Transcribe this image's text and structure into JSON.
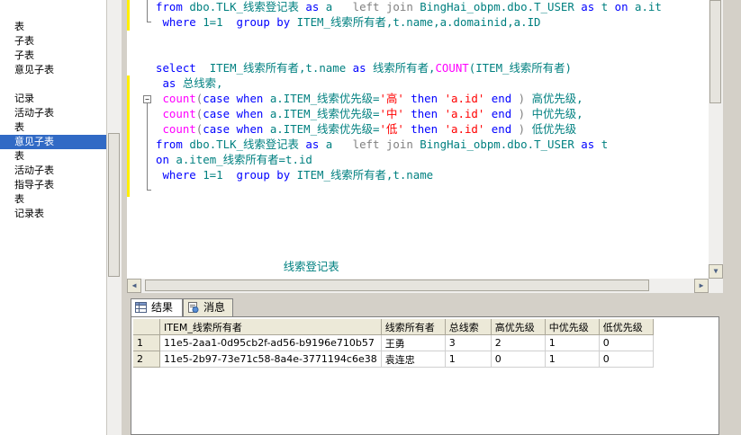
{
  "explorer": {
    "items": [
      "表",
      "子表",
      "子表",
      "意见子表",
      "",
      "记录",
      "活动子表",
      "表",
      "意见子表",
      "表",
      "活动子表",
      "指导子表",
      "表",
      "记录表"
    ],
    "selected_index": 8
  },
  "editor": {
    "lines": [
      [
        {
          "t": "from ",
          "c": "kw"
        },
        {
          "t": "dbo.TLK_线索登记表 ",
          "c": "obj"
        },
        {
          "t": "as ",
          "c": "kw"
        },
        {
          "t": "a   ",
          "c": "obj"
        },
        {
          "t": "left join ",
          "c": "gray"
        },
        {
          "t": "BingHai_obpm.dbo.T_USER ",
          "c": "obj"
        },
        {
          "t": "as ",
          "c": "kw"
        },
        {
          "t": "t ",
          "c": "obj"
        },
        {
          "t": "on ",
          "c": "kw"
        },
        {
          "t": "a.it",
          "c": "obj"
        }
      ],
      [
        {
          "t": " where ",
          "c": "kw"
        },
        {
          "t": "1=1  ",
          "c": "obj"
        },
        {
          "t": "group by ",
          "c": "kw"
        },
        {
          "t": "ITEM_线索所有者,t.name,a.domainid,a.ID",
          "c": "obj"
        }
      ],
      [],
      [],
      [
        {
          "t": "select  ",
          "c": "kw"
        },
        {
          "t": "ITEM_线索所有者,t.name ",
          "c": "obj"
        },
        {
          "t": "as ",
          "c": "kw"
        },
        {
          "t": "线索所有者,",
          "c": "obj"
        },
        {
          "t": "COUNT",
          "c": "fn"
        },
        {
          "t": "(ITEM_线索所有者)",
          "c": "obj"
        }
      ],
      [
        {
          "t": " as ",
          "c": "kw"
        },
        {
          "t": "总线索,",
          "c": "obj"
        }
      ],
      [
        {
          "t": " count",
          "c": "fn"
        },
        {
          "t": "(",
          "c": "gray"
        },
        {
          "t": "case when ",
          "c": "kw"
        },
        {
          "t": "a.ITEM_线索优先级=",
          "c": "obj"
        },
        {
          "t": "'高'",
          "c": "str"
        },
        {
          "t": " then ",
          "c": "kw"
        },
        {
          "t": "'a.id'",
          "c": "str"
        },
        {
          "t": " end ",
          "c": "kw"
        },
        {
          "t": ") ",
          "c": "gray"
        },
        {
          "t": "高优先级,",
          "c": "obj"
        }
      ],
      [
        {
          "t": " count",
          "c": "fn"
        },
        {
          "t": "(",
          "c": "gray"
        },
        {
          "t": "case when ",
          "c": "kw"
        },
        {
          "t": "a.ITEM_线索优先级=",
          "c": "obj"
        },
        {
          "t": "'中'",
          "c": "str"
        },
        {
          "t": " then ",
          "c": "kw"
        },
        {
          "t": "'a.id'",
          "c": "str"
        },
        {
          "t": " end ",
          "c": "kw"
        },
        {
          "t": ") ",
          "c": "gray"
        },
        {
          "t": "中优先级,",
          "c": "obj"
        }
      ],
      [
        {
          "t": " count",
          "c": "fn"
        },
        {
          "t": "(",
          "c": "gray"
        },
        {
          "t": "case when ",
          "c": "kw"
        },
        {
          "t": "a.ITEM_线索优先级=",
          "c": "obj"
        },
        {
          "t": "'低'",
          "c": "str"
        },
        {
          "t": " then ",
          "c": "kw"
        },
        {
          "t": "'a.id'",
          "c": "str"
        },
        {
          "t": " end ",
          "c": "kw"
        },
        {
          "t": ") ",
          "c": "gray"
        },
        {
          "t": "低优先级",
          "c": "obj"
        }
      ],
      [
        {
          "t": "from ",
          "c": "kw"
        },
        {
          "t": "dbo.TLK_线索登记表 ",
          "c": "obj"
        },
        {
          "t": "as ",
          "c": "kw"
        },
        {
          "t": "a   ",
          "c": "obj"
        },
        {
          "t": "left join ",
          "c": "gray"
        },
        {
          "t": "BingHai_obpm.dbo.T_USER ",
          "c": "obj"
        },
        {
          "t": "as ",
          "c": "kw"
        },
        {
          "t": "t",
          "c": "obj"
        }
      ],
      [
        {
          "t": "on ",
          "c": "kw"
        },
        {
          "t": "a.item_线索所有者=t.id",
          "c": "obj"
        }
      ],
      [
        {
          "t": " where ",
          "c": "kw"
        },
        {
          "t": "1=1  ",
          "c": "obj"
        },
        {
          "t": "group by ",
          "c": "kw"
        },
        {
          "t": "ITEM_线索所有者,t.name",
          "c": "obj"
        }
      ],
      [],
      [],
      [],
      [],
      [],
      [
        {
          "t": "                   线索登记表",
          "c": "obj"
        }
      ]
    ]
  },
  "results": {
    "tabs": [
      {
        "label": "结果",
        "icon": "grid-icon",
        "active": true
      },
      {
        "label": "消息",
        "icon": "messages-icon",
        "active": false
      }
    ],
    "columns": [
      "ITEM_线索所有者",
      "线索所有者",
      "总线索",
      "高优先级",
      "中优先级",
      "低优先级"
    ],
    "rows": [
      {
        "num": "1",
        "cells": [
          "11e5-2aa1-0d95cb2f-ad56-b9196e710b57",
          "王勇",
          "3",
          "2",
          "1",
          "0"
        ]
      },
      {
        "num": "2",
        "cells": [
          "11e5-2b97-73e71c58-8a4e-3771194c6e38",
          "袁连忠",
          "1",
          "0",
          "1",
          "0"
        ]
      }
    ]
  },
  "colors": {
    "keyword": "#0000ff",
    "function": "#ff00ff",
    "string": "#ff0000",
    "operator": "#808080",
    "object": "#008080",
    "selection": "#316ac5"
  }
}
